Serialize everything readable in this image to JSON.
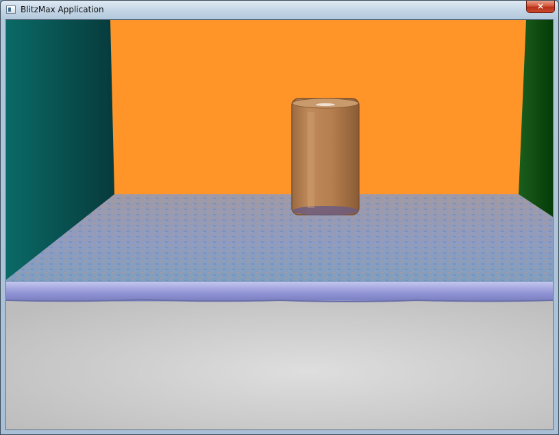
{
  "window": {
    "title": "BlitzMax Application",
    "close_label": "×"
  },
  "scene": {
    "back_wall_color": "#ff9428",
    "left_wall_color": "#0e5e5c",
    "right_wall_color": "#0b4a0d",
    "floor_color": "#d6d6d6",
    "water_color": "#8a96c4",
    "glass_color": "#b07a4a"
  }
}
